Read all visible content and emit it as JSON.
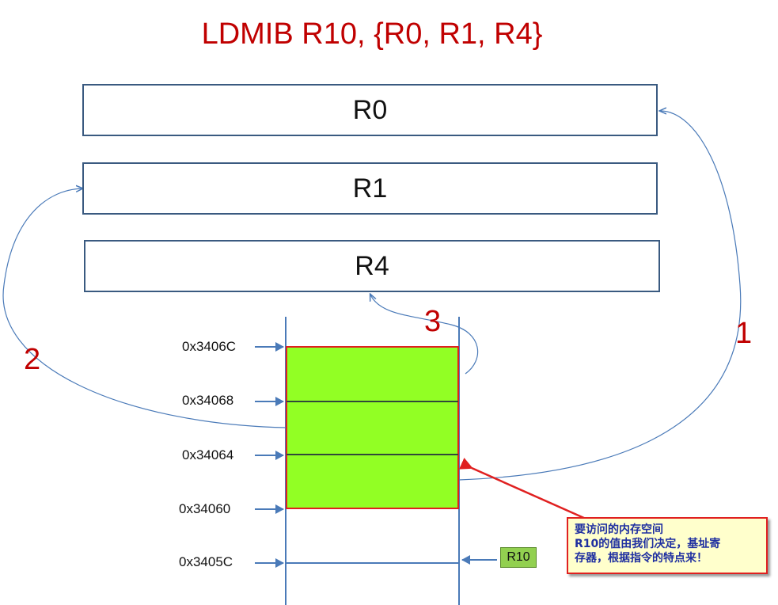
{
  "title": "LDMIB R10,  {R0, R1, R4}",
  "registers": [
    "R0",
    "R1",
    "R4"
  ],
  "addresses": [
    "0x3406C",
    "0x34068",
    "0x34064",
    "0x34060",
    "0x3405C"
  ],
  "steps": [
    "1",
    "2",
    "3"
  ],
  "base_register_label": "R10",
  "note": {
    "lines": [
      "要访问的内存空间",
      "R10的值由我们决定，基址寄",
      "存器，根据指令的特点来！"
    ]
  },
  "colors": {
    "title": "#c00000",
    "memory_fill": "#92ff24",
    "memory_border": "#e02020",
    "line_blue": "#4a7ab8",
    "register_border": "#3a5a80",
    "note_background": "#ffffcc",
    "note_text": "#1f2fa0"
  }
}
